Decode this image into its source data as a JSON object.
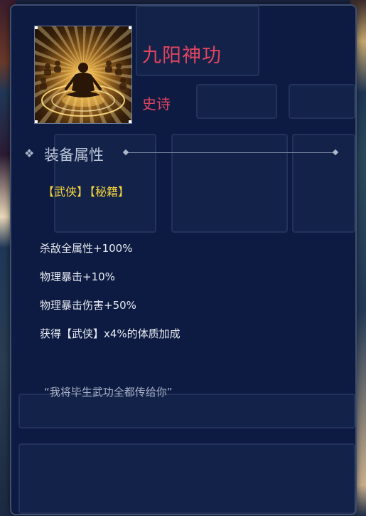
{
  "item": {
    "name": "九阳神功",
    "rarity": "史诗",
    "name_color": "#e0455e"
  },
  "section": {
    "title": "装备属性",
    "icon": "diamond-icon"
  },
  "tags": [
    "【武侠】",
    "【秘籍】"
  ],
  "attributes": [
    "杀敌全属性+100%",
    "物理暴击+10%",
    "物理暴击伤害+50%",
    "获得【武侠】x4%的体质加成"
  ],
  "quote": "“我将毕生武功全都传给你”",
  "colors": {
    "panel_bg": "#0d1b42",
    "tag": "#f4d43c",
    "text": "#e8ebf2"
  }
}
